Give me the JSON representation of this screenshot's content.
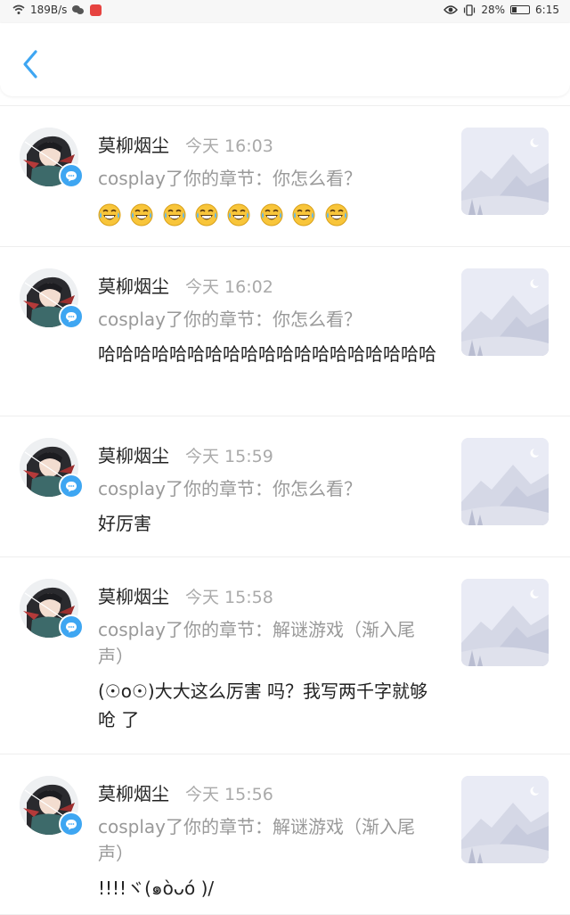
{
  "status_bar": {
    "net_speed": "189B/s",
    "battery_percent": "28%",
    "battery_level": 0.28,
    "time": "6:15"
  },
  "header": {
    "back_icon": "chevron-left-icon",
    "accent_color": "#3ea6f2"
  },
  "notifications": [
    {
      "username": "莫柳烟尘",
      "timestamp": "今天 16:03",
      "context": "cosplay了你的章节：你怎么看？",
      "message": "",
      "emoji_name": "laugh-cry-emoji",
      "emoji_count": 8
    },
    {
      "username": "莫柳烟尘",
      "timestamp": "今天 16:02",
      "context": "cosplay了你的章节：你怎么看？",
      "message": "哈哈哈哈哈哈哈哈哈哈哈哈哈哈哈哈哈哈哈"
    },
    {
      "username": "莫柳烟尘",
      "timestamp": "今天 15:59",
      "context": "cosplay了你的章节：你怎么看？",
      "message": "好厉害"
    },
    {
      "username": "莫柳烟尘",
      "timestamp": "今天 15:58",
      "context": "cosplay了你的章节：解谜游戏（渐入尾声）",
      "message": "(☉o☉)大大这么厉害 吗？我写两千字就够呛 了"
    },
    {
      "username": "莫柳烟尘",
      "timestamp": "今天 15:56",
      "context": "cosplay了你的章节：解谜游戏（渐入尾声）",
      "message": "!!!!ヾ(๑òᴗó )/"
    }
  ]
}
